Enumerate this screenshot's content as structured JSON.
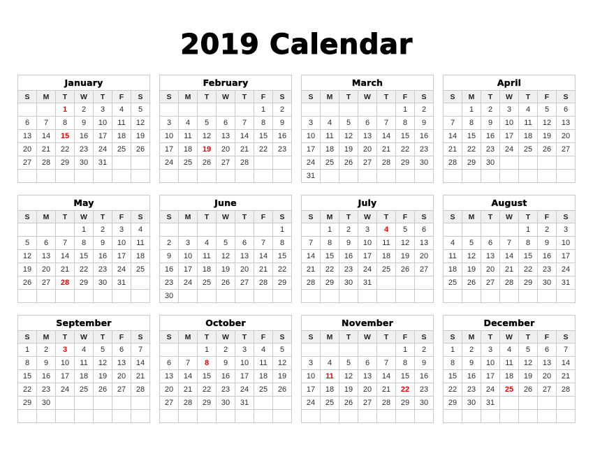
{
  "title": "2019 Calendar",
  "colors": {
    "holiday": "#ee0000",
    "day_text": "#2b2b2b",
    "weekday_header_bg": "#f0f0f0",
    "border": "#c9c9c9",
    "page_bg": "#ffffff",
    "title_text": "#000000"
  },
  "weekdays": [
    "S",
    "M",
    "T",
    "W",
    "T",
    "F",
    "S"
  ],
  "months": [
    {
      "name": "January",
      "weeks": [
        [
          "",
          "",
          "1",
          "2",
          "3",
          "4",
          "5"
        ],
        [
          "6",
          "7",
          "8",
          "9",
          "10",
          "11",
          "12"
        ],
        [
          "13",
          "14",
          "15",
          "16",
          "17",
          "18",
          "19"
        ],
        [
          "20",
          "21",
          "22",
          "23",
          "24",
          "25",
          "26"
        ],
        [
          "27",
          "28",
          "29",
          "30",
          "31",
          "",
          ""
        ],
        [
          "",
          "",
          "",
          "",
          "",
          "",
          ""
        ]
      ],
      "holidays": [
        "1",
        "15"
      ]
    },
    {
      "name": "February",
      "weeks": [
        [
          "",
          "",
          "",
          "",
          "",
          "1",
          "2"
        ],
        [
          "3",
          "4",
          "5",
          "6",
          "7",
          "8",
          "9"
        ],
        [
          "10",
          "11",
          "12",
          "13",
          "14",
          "15",
          "16"
        ],
        [
          "17",
          "18",
          "19",
          "20",
          "21",
          "22",
          "23"
        ],
        [
          "24",
          "25",
          "26",
          "27",
          "28",
          "",
          ""
        ],
        [
          "",
          "",
          "",
          "",
          "",
          "",
          ""
        ]
      ],
      "holidays": [
        "19"
      ]
    },
    {
      "name": "March",
      "weeks": [
        [
          "",
          "",
          "",
          "",
          "",
          "1",
          "2"
        ],
        [
          "3",
          "4",
          "5",
          "6",
          "7",
          "8",
          "9"
        ],
        [
          "10",
          "11",
          "12",
          "13",
          "14",
          "15",
          "16"
        ],
        [
          "17",
          "18",
          "19",
          "20",
          "21",
          "22",
          "23"
        ],
        [
          "24",
          "25",
          "26",
          "27",
          "28",
          "29",
          "30"
        ],
        [
          "31",
          "",
          "",
          "",
          "",
          "",
          ""
        ]
      ],
      "holidays": []
    },
    {
      "name": "April",
      "weeks": [
        [
          "",
          "1",
          "2",
          "3",
          "4",
          "5",
          "6"
        ],
        [
          "7",
          "8",
          "9",
          "10",
          "11",
          "12",
          "13"
        ],
        [
          "14",
          "15",
          "16",
          "17",
          "18",
          "19",
          "20"
        ],
        [
          "21",
          "22",
          "23",
          "24",
          "25",
          "26",
          "27"
        ],
        [
          "28",
          "29",
          "30",
          "",
          "",
          "",
          ""
        ],
        [
          "",
          "",
          "",
          "",
          "",
          "",
          ""
        ]
      ],
      "holidays": []
    },
    {
      "name": "May",
      "weeks": [
        [
          "",
          "",
          "",
          "1",
          "2",
          "3",
          "4"
        ],
        [
          "5",
          "6",
          "7",
          "8",
          "9",
          "10",
          "11"
        ],
        [
          "12",
          "13",
          "14",
          "15",
          "16",
          "17",
          "18"
        ],
        [
          "19",
          "20",
          "21",
          "22",
          "23",
          "24",
          "25"
        ],
        [
          "26",
          "27",
          "28",
          "29",
          "30",
          "31",
          ""
        ],
        [
          "",
          "",
          "",
          "",
          "",
          "",
          ""
        ]
      ],
      "holidays": [
        "28"
      ]
    },
    {
      "name": "June",
      "weeks": [
        [
          "",
          "",
          "",
          "",
          "",
          "",
          "1"
        ],
        [
          "2",
          "3",
          "4",
          "5",
          "6",
          "7",
          "8"
        ],
        [
          "9",
          "10",
          "11",
          "12",
          "13",
          "14",
          "15"
        ],
        [
          "16",
          "17",
          "18",
          "19",
          "20",
          "21",
          "22"
        ],
        [
          "23",
          "24",
          "25",
          "26",
          "27",
          "28",
          "29"
        ],
        [
          "30",
          "",
          "",
          "",
          "",
          "",
          ""
        ]
      ],
      "holidays": []
    },
    {
      "name": "July",
      "weeks": [
        [
          "",
          "1",
          "2",
          "3",
          "4",
          "5",
          "6"
        ],
        [
          "7",
          "8",
          "9",
          "10",
          "11",
          "12",
          "13"
        ],
        [
          "14",
          "15",
          "16",
          "17",
          "18",
          "19",
          "20"
        ],
        [
          "21",
          "22",
          "23",
          "24",
          "25",
          "26",
          "27"
        ],
        [
          "28",
          "29",
          "30",
          "31",
          "",
          "",
          ""
        ],
        [
          "",
          "",
          "",
          "",
          "",
          "",
          ""
        ]
      ],
      "holidays": [
        "4"
      ]
    },
    {
      "name": "August",
      "weeks": [
        [
          "",
          "",
          "",
          "",
          "1",
          "2",
          "3"
        ],
        [
          "4",
          "5",
          "6",
          "7",
          "8",
          "9",
          "10"
        ],
        [
          "11",
          "12",
          "13",
          "14",
          "15",
          "16",
          "17"
        ],
        [
          "18",
          "19",
          "20",
          "21",
          "22",
          "23",
          "24"
        ],
        [
          "25",
          "26",
          "27",
          "28",
          "29",
          "30",
          "31"
        ],
        [
          "",
          "",
          "",
          "",
          "",
          "",
          ""
        ]
      ],
      "holidays": []
    },
    {
      "name": "September",
      "weeks": [
        [
          "1",
          "2",
          "3",
          "4",
          "5",
          "6",
          "7"
        ],
        [
          "8",
          "9",
          "10",
          "11",
          "12",
          "13",
          "14"
        ],
        [
          "15",
          "16",
          "17",
          "18",
          "19",
          "20",
          "21"
        ],
        [
          "22",
          "23",
          "24",
          "25",
          "26",
          "27",
          "28"
        ],
        [
          "29",
          "30",
          "",
          "",
          "",
          "",
          ""
        ],
        [
          "",
          "",
          "",
          "",
          "",
          "",
          ""
        ]
      ],
      "holidays": [
        "3"
      ]
    },
    {
      "name": "October",
      "weeks": [
        [
          "",
          "",
          "1",
          "2",
          "3",
          "4",
          "5"
        ],
        [
          "6",
          "7",
          "8",
          "9",
          "10",
          "11",
          "12"
        ],
        [
          "13",
          "14",
          "15",
          "16",
          "17",
          "18",
          "19"
        ],
        [
          "20",
          "21",
          "22",
          "23",
          "24",
          "25",
          "26"
        ],
        [
          "27",
          "28",
          "29",
          "30",
          "31",
          "",
          ""
        ],
        [
          "",
          "",
          "",
          "",
          "",
          "",
          ""
        ]
      ],
      "holidays": [
        "8"
      ]
    },
    {
      "name": "November",
      "weeks": [
        [
          "",
          "",
          "",
          "",
          "",
          "1",
          "2"
        ],
        [
          "3",
          "4",
          "5",
          "6",
          "7",
          "8",
          "9"
        ],
        [
          "10",
          "11",
          "12",
          "13",
          "14",
          "15",
          "16"
        ],
        [
          "17",
          "18",
          "19",
          "20",
          "21",
          "22",
          "23"
        ],
        [
          "24",
          "25",
          "26",
          "27",
          "28",
          "29",
          "30"
        ],
        [
          "",
          "",
          "",
          "",
          "",
          "",
          ""
        ]
      ],
      "holidays": [
        "11",
        "22"
      ]
    },
    {
      "name": "December",
      "weeks": [
        [
          "1",
          "2",
          "3",
          "4",
          "5",
          "6",
          "7"
        ],
        [
          "8",
          "9",
          "10",
          "11",
          "12",
          "13",
          "14"
        ],
        [
          "15",
          "16",
          "17",
          "18",
          "19",
          "20",
          "21"
        ],
        [
          "22",
          "23",
          "24",
          "25",
          "26",
          "27",
          "28"
        ],
        [
          "29",
          "30",
          "31",
          "",
          "",
          "",
          ""
        ],
        [
          "",
          "",
          "",
          "",
          "",
          "",
          ""
        ]
      ],
      "holidays": [
        "25"
      ]
    }
  ]
}
